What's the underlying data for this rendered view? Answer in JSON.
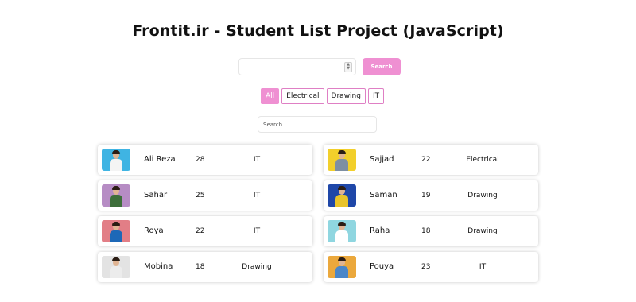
{
  "page": {
    "title": "Frontit.ir - Student List Project (JavaScript)"
  },
  "search": {
    "number_value": "",
    "button_label": "Search",
    "text_placeholder": "Search ...",
    "text_value": ""
  },
  "filters": [
    {
      "label": "All",
      "active": true
    },
    {
      "label": "Electrical",
      "active": false
    },
    {
      "label": "Drawing",
      "active": false
    },
    {
      "label": "IT",
      "active": false
    }
  ],
  "colors": {
    "accent": "#ef90d2",
    "accent_border": "#df7fc4"
  },
  "students": [
    {
      "name": "Ali Reza",
      "age": "28",
      "field": "IT",
      "photo_bg": "#3fb4e3",
      "shirt": "#f4f4f4"
    },
    {
      "name": "Sajjad",
      "age": "22",
      "field": "Electrical",
      "photo_bg": "#f2cf2b",
      "shirt": "#7e8fa3"
    },
    {
      "name": "Sahar",
      "age": "25",
      "field": "IT",
      "photo_bg": "#b68cc4",
      "shirt": "#3d6e3a"
    },
    {
      "name": "Saman",
      "age": "19",
      "field": "Drawing",
      "photo_bg": "#1f47a8",
      "shirt": "#e9c32a"
    },
    {
      "name": "Roya",
      "age": "22",
      "field": "IT",
      "photo_bg": "#e27e86",
      "shirt": "#1d68b7"
    },
    {
      "name": "Raha",
      "age": "18",
      "field": "Drawing",
      "photo_bg": "#8fd6e0",
      "shirt": "#ffffff"
    },
    {
      "name": "Mobina",
      "age": "18",
      "field": "Drawing",
      "photo_bg": "#e3e3e3",
      "shirt": "#ececec"
    },
    {
      "name": "Pouya",
      "age": "23",
      "field": "IT",
      "photo_bg": "#eba83c",
      "shirt": "#4a86c8"
    }
  ]
}
